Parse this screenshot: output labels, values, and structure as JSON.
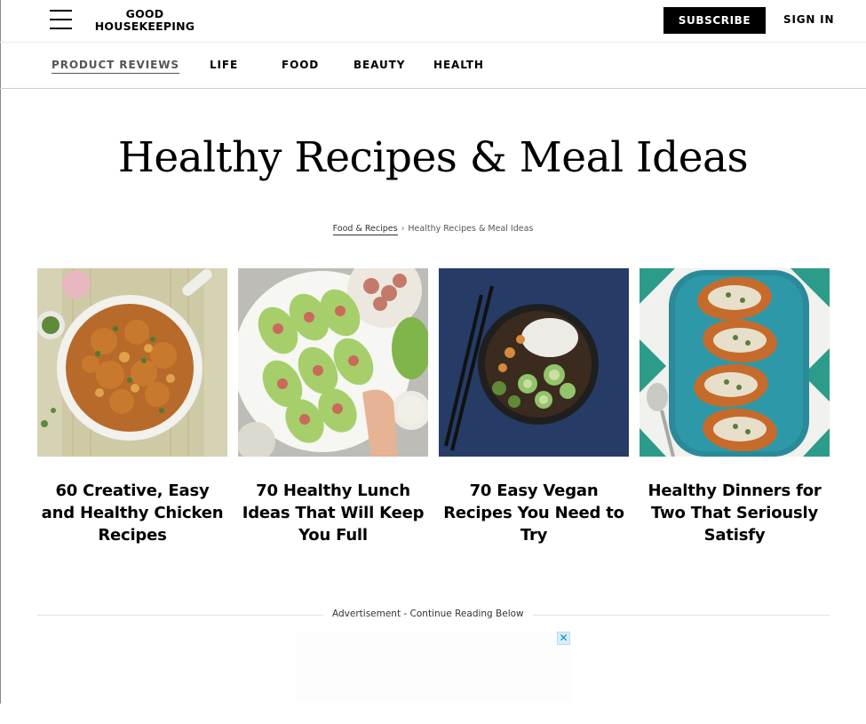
{
  "header": {
    "logo_line1": "GOOD",
    "logo_line2": "HOUSEKEEPING",
    "subscribe_label": "SUBSCRIBE",
    "signin_label": "SIGN IN",
    "menu_icon": "hamburger-menu-icon"
  },
  "nav": {
    "items": [
      {
        "label": "PRODUCT REVIEWS",
        "active": true
      },
      {
        "label": "LIFE"
      },
      {
        "label": "FOOD"
      },
      {
        "label": "BEAUTY"
      },
      {
        "label": "HEALTH"
      }
    ]
  },
  "page": {
    "title": "Healthy Recipes & Meal Ideas"
  },
  "breadcrumb": {
    "parent": "Food & Recipes",
    "separator": "›",
    "current": "Healthy Recipes & Meal Ideas"
  },
  "cards": [
    {
      "title": "60 Creative, Easy and Healthy Chicken Recipes",
      "image": "chicken-skillet-photo"
    },
    {
      "title": "70 Healthy Lunch Ideas That Will Keep You Full",
      "image": "lettuce-wraps-photo"
    },
    {
      "title": "70 Easy Vegan Recipes You Need to Try",
      "image": "vegan-bowl-photo"
    },
    {
      "title": "Healthy Dinners for Two That Seriously Satisfy",
      "image": "stuffed-squash-photo"
    }
  ],
  "ad": {
    "label": "Advertisement - Continue Reading Below",
    "close_icon": "close-icon",
    "close_glyph": "✕"
  },
  "colors": {
    "accent": "#000000",
    "background": "#ffffff",
    "ad_close": "#0091c8"
  }
}
